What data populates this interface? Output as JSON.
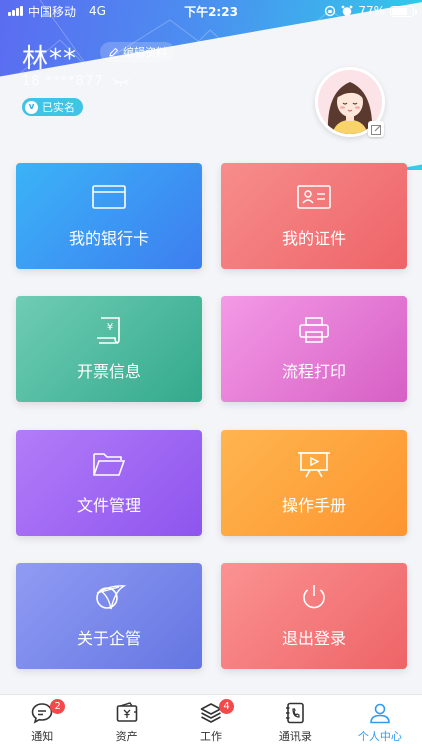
{
  "status_bar": {
    "carrier": "中国移动",
    "network": "4G",
    "time": "下午2:23",
    "battery_text": "77%",
    "battery_level": 0.77
  },
  "profile": {
    "name": "林**",
    "edit_label": "编辑资料",
    "phone": "18  ****877",
    "verified_label": "已实名",
    "verified_mark": "v"
  },
  "tiles": [
    {
      "label": "我的银行卡",
      "icon": "bank-card-icon",
      "color": "#3d8ef3"
    },
    {
      "label": "我的证件",
      "icon": "id-card-icon",
      "color": "#f2777a"
    },
    {
      "label": "开票信息",
      "icon": "invoice-yen-icon",
      "color": "#3fb194",
      "symbol": "¥"
    },
    {
      "label": "流程打印",
      "icon": "printer-icon",
      "color": "#dc6bcd"
    },
    {
      "label": "文件管理",
      "icon": "folder-icon",
      "color": "#9a62f1"
    },
    {
      "label": "操作手册",
      "icon": "presentation-icon",
      "color": "#fea03c"
    },
    {
      "label": "关于企管",
      "icon": "company-logo-icon",
      "color": "#7585e9"
    },
    {
      "label": "退出登录",
      "icon": "power-icon",
      "color": "#f27476"
    }
  ],
  "tabbar": {
    "items": [
      {
        "label": "通知",
        "icon": "chat-bubble-icon",
        "badge": "2",
        "active": false
      },
      {
        "label": "资产",
        "icon": "wallet-icon",
        "badge": "",
        "active": false
      },
      {
        "label": "工作",
        "icon": "layers-icon",
        "badge": "4",
        "active": false
      },
      {
        "label": "通讯录",
        "icon": "contacts-phone-icon",
        "badge": "",
        "active": false
      },
      {
        "label": "个人中心",
        "icon": "person-icon",
        "badge": "",
        "active": true
      }
    ],
    "active_color": "#2e9df0"
  }
}
